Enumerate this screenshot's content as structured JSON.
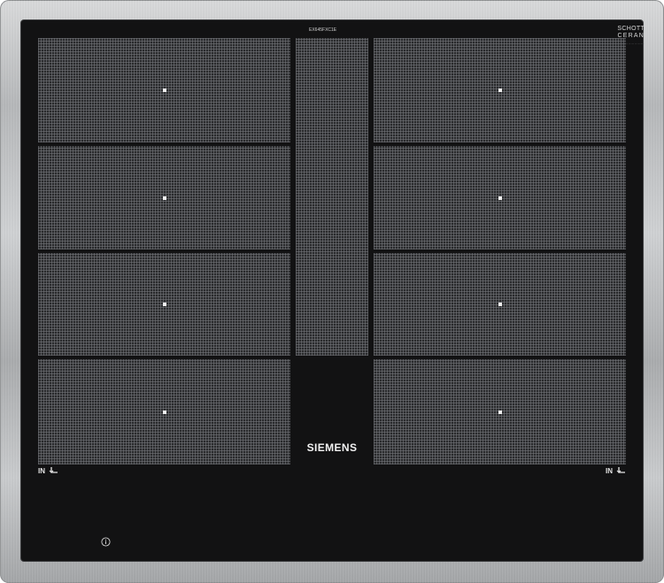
{
  "appliance": {
    "brand": "SIEMENS",
    "model_code": "EX645FXC1E",
    "glass_maker": "SCHOTT",
    "glass_line": "CERAN",
    "glass_note": "...............",
    "left_indicator": "IN",
    "right_indicator": "IN",
    "icons": [
      "power-connection-icon",
      "info-icon"
    ],
    "colors": {
      "glass": "#121213",
      "zone_grid": "#2a2b2d",
      "frame": "#b5b7b9",
      "text": "#f2f2f2"
    }
  },
  "zones": {
    "left_column_count": 4,
    "right_column_count": 4,
    "center_bridge_count": 1
  }
}
